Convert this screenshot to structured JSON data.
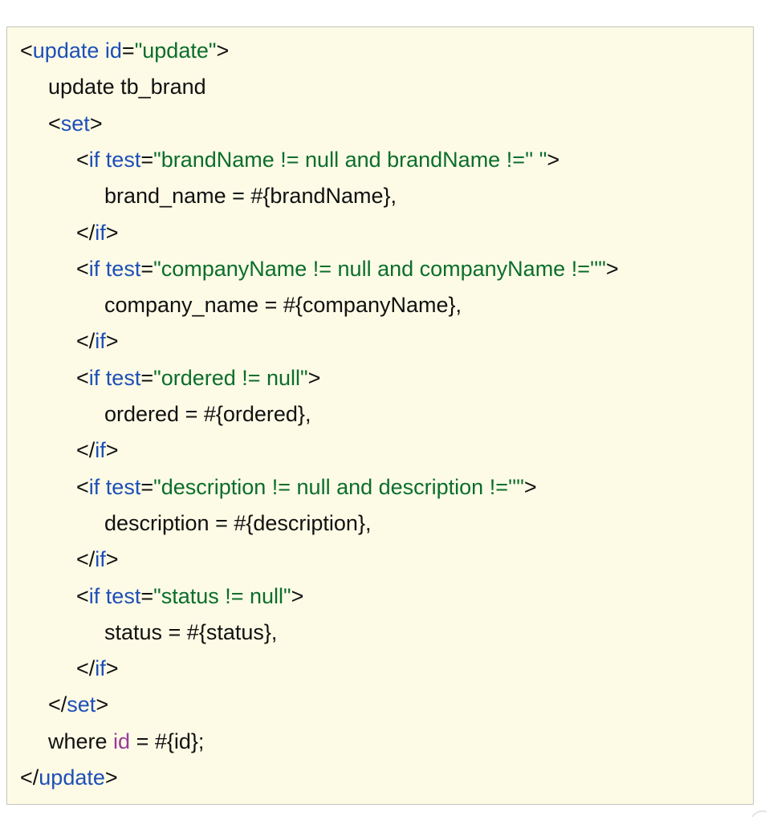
{
  "code": {
    "lines": [
      {
        "indent": 0,
        "segments": [
          {
            "t": "<",
            "k": "default"
          },
          {
            "t": "update",
            "k": "tag"
          },
          {
            "t": " ",
            "k": "default"
          },
          {
            "t": "id",
            "k": "attr"
          },
          {
            "t": "=",
            "k": "default"
          },
          {
            "t": "\"update\"",
            "k": "string"
          },
          {
            "t": ">",
            "k": "default"
          }
        ]
      },
      {
        "indent": 1,
        "segments": [
          {
            "t": "update tb_brand",
            "k": "default"
          }
        ]
      },
      {
        "indent": 1,
        "segments": [
          {
            "t": "<",
            "k": "default"
          },
          {
            "t": "set",
            "k": "tag"
          },
          {
            "t": ">",
            "k": "default"
          }
        ]
      },
      {
        "indent": 2,
        "segments": [
          {
            "t": "<",
            "k": "default"
          },
          {
            "t": "if",
            "k": "tag"
          },
          {
            "t": " ",
            "k": "default"
          },
          {
            "t": "test",
            "k": "attr"
          },
          {
            "t": "=",
            "k": "default"
          },
          {
            "t": "\"brandName != null and brandName !='' \"",
            "k": "string"
          },
          {
            "t": ">",
            "k": "default"
          }
        ]
      },
      {
        "indent": 3,
        "segments": [
          {
            "t": "brand_name = #{brandName},",
            "k": "default"
          }
        ]
      },
      {
        "indent": 2,
        "segments": [
          {
            "t": "</",
            "k": "default"
          },
          {
            "t": "if",
            "k": "tag"
          },
          {
            "t": ">",
            "k": "default"
          }
        ]
      },
      {
        "indent": 2,
        "segments": [
          {
            "t": "<",
            "k": "default"
          },
          {
            "t": "if",
            "k": "tag"
          },
          {
            "t": " ",
            "k": "default"
          },
          {
            "t": "test",
            "k": "attr"
          },
          {
            "t": "=",
            "k": "default"
          },
          {
            "t": "\"companyName != null and companyName !=''\"",
            "k": "string"
          },
          {
            "t": ">",
            "k": "default"
          }
        ]
      },
      {
        "indent": 3,
        "segments": [
          {
            "t": "company_name = #{companyName},",
            "k": "default"
          }
        ]
      },
      {
        "indent": 2,
        "segments": [
          {
            "t": "</",
            "k": "default"
          },
          {
            "t": "if",
            "k": "tag"
          },
          {
            "t": ">",
            "k": "default"
          }
        ]
      },
      {
        "indent": 2,
        "segments": [
          {
            "t": "<",
            "k": "default"
          },
          {
            "t": "if",
            "k": "tag"
          },
          {
            "t": " ",
            "k": "default"
          },
          {
            "t": "test",
            "k": "attr"
          },
          {
            "t": "=",
            "k": "default"
          },
          {
            "t": "\"ordered != null\"",
            "k": "string"
          },
          {
            "t": ">",
            "k": "default"
          }
        ]
      },
      {
        "indent": 3,
        "segments": [
          {
            "t": "ordered = #{ordered},",
            "k": "default"
          }
        ]
      },
      {
        "indent": 2,
        "segments": [
          {
            "t": "</",
            "k": "default"
          },
          {
            "t": "if",
            "k": "tag"
          },
          {
            "t": ">",
            "k": "default"
          }
        ]
      },
      {
        "indent": 2,
        "segments": [
          {
            "t": "<",
            "k": "default"
          },
          {
            "t": "if",
            "k": "tag"
          },
          {
            "t": " ",
            "k": "default"
          },
          {
            "t": "test",
            "k": "attr"
          },
          {
            "t": "=",
            "k": "default"
          },
          {
            "t": "\"description != null and description !=''\"",
            "k": "string"
          },
          {
            "t": ">",
            "k": "default"
          }
        ]
      },
      {
        "indent": 3,
        "segments": [
          {
            "t": "description = #{description},",
            "k": "default"
          }
        ]
      },
      {
        "indent": 2,
        "segments": [
          {
            "t": "</",
            "k": "default"
          },
          {
            "t": "if",
            "k": "tag"
          },
          {
            "t": ">",
            "k": "default"
          }
        ]
      },
      {
        "indent": 2,
        "segments": [
          {
            "t": "<",
            "k": "default"
          },
          {
            "t": "if",
            "k": "tag"
          },
          {
            "t": " ",
            "k": "default"
          },
          {
            "t": "test",
            "k": "attr"
          },
          {
            "t": "=",
            "k": "default"
          },
          {
            "t": "\"status != null\"",
            "k": "string"
          },
          {
            "t": ">",
            "k": "default"
          }
        ]
      },
      {
        "indent": 3,
        "segments": [
          {
            "t": "status = #{status},",
            "k": "default"
          }
        ]
      },
      {
        "indent": 2,
        "segments": [
          {
            "t": "</",
            "k": "default"
          },
          {
            "t": "if",
            "k": "tag"
          },
          {
            "t": ">",
            "k": "default"
          }
        ]
      },
      {
        "indent": 1,
        "segments": [
          {
            "t": "</",
            "k": "default"
          },
          {
            "t": "set",
            "k": "tag"
          },
          {
            "t": ">",
            "k": "default"
          }
        ]
      },
      {
        "indent": 1,
        "segments": [
          {
            "t": "where ",
            "k": "default"
          },
          {
            "t": "id",
            "k": "keyword"
          },
          {
            "t": " = #{id};",
            "k": "default"
          }
        ]
      },
      {
        "indent": 0,
        "segments": [
          {
            "t": "</",
            "k": "default"
          },
          {
            "t": "update",
            "k": "tag"
          },
          {
            "t": ">",
            "k": "default"
          }
        ]
      }
    ]
  },
  "colors": {
    "background": "#fdfbe6",
    "tag": "#1d4fb8",
    "attr": "#1d4fb8",
    "string": "#0b6e2b",
    "keyword": "#9b3a9b",
    "text": "#111111"
  }
}
